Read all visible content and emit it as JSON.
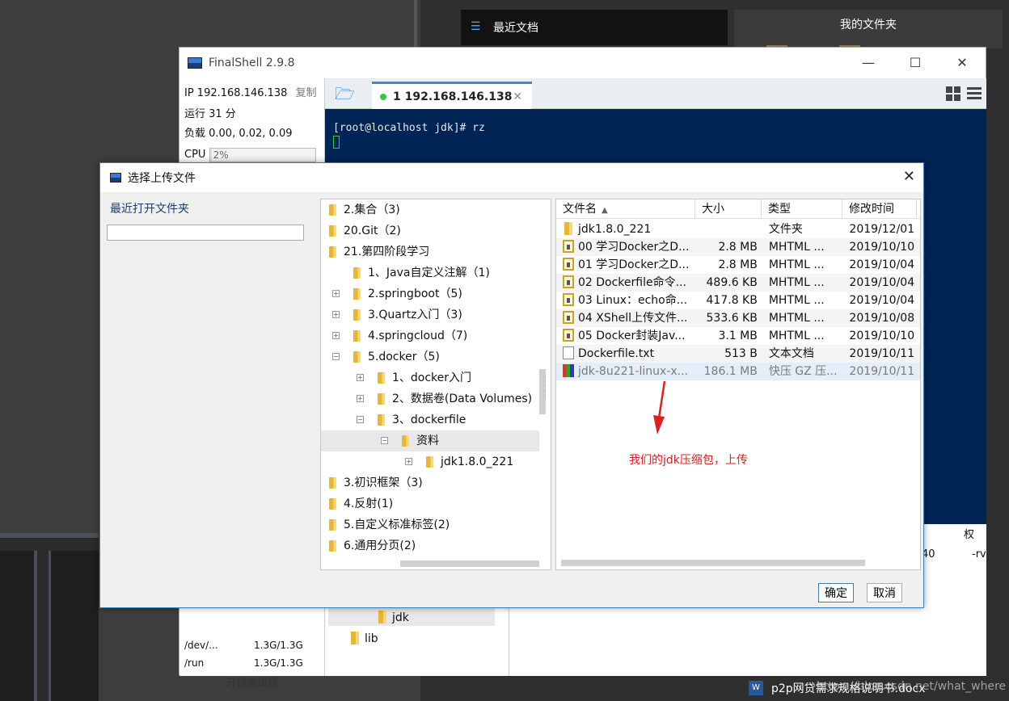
{
  "desktop": {
    "recent_docs_label": "最近文档",
    "my_folder_label": "我的文件夹",
    "taskbar_doc": "p2p网贷需求规格说明书.docx",
    "watermark": "https://blog.csdn.net/what_where"
  },
  "finalshell": {
    "title": "FinalShell 2.9.8",
    "ip_label": "IP 192.168.146.138",
    "copy_label": "复制",
    "uptime": "运行 31 分",
    "load": "负载 0.00, 0.02, 0.09",
    "cpu_label": "CPU",
    "cpu_value": "2%",
    "cpu_fraction": 0.02,
    "disks": [
      {
        "path": "/dev/...",
        "size": "1.3G/1.3G"
      },
      {
        "path": "/run",
        "size": "1.3G/1.3G"
      }
    ],
    "upgrade_label": "升级高级版",
    "tab_label": "1 192.168.146.138",
    "terminal_line": "[root@localhost jdk]# rz",
    "lower_col_head": "权",
    "lower_val1": "40",
    "lower_val2": "-rv",
    "lower_tree": [
      {
        "label": "jdk"
      },
      {
        "label": "lib"
      }
    ]
  },
  "dialog": {
    "title": "选择上传文件",
    "recent_folder_label": "最近打开文件夹",
    "recent_folder_value": "",
    "tree": [
      {
        "label": "2.集合（3)",
        "expander": ""
      },
      {
        "label": "20.Git（2)",
        "expander": ""
      },
      {
        "label": "21.第四阶段学习",
        "expander": ""
      },
      {
        "label": "1、Java自定义注解（1)",
        "expander": ""
      },
      {
        "label": "2.springboot（5)",
        "expander": "+"
      },
      {
        "label": "3.Quartz入门（3)",
        "expander": "+"
      },
      {
        "label": "4.springcloud（7)",
        "expander": "+"
      },
      {
        "label": "5.docker（5)",
        "expander": "−"
      },
      {
        "label": "1、docker入门",
        "expander": "+"
      },
      {
        "label": "2、数据卷(Data Volumes)",
        "expander": "+"
      },
      {
        "label": "3、dockerfile",
        "expander": "−"
      },
      {
        "label": "资料",
        "expander": "−"
      },
      {
        "label": "jdk1.8.0_221",
        "expander": "+"
      },
      {
        "label": "3.初识框架（3)",
        "expander": ""
      },
      {
        "label": "4.反射(1)",
        "expander": ""
      },
      {
        "label": "5.自定义标准标签(2)",
        "expander": ""
      },
      {
        "label": "6.通用分页(2)",
        "expander": ""
      }
    ],
    "columns": {
      "name": "文件名",
      "size": "大小",
      "type": "类型",
      "modified": "修改时间"
    },
    "files": [
      {
        "name": "jdk1.8.0_221",
        "size": "",
        "type": "文件夹",
        "modified": "2019/12/01",
        "icon": "folder-icon"
      },
      {
        "name": "00 学习Docker之D...",
        "size": "2.8 MB",
        "type": "MHTML ...",
        "modified": "2019/10/10",
        "icon": "mhtml-icon"
      },
      {
        "name": "01 学习Docker之D...",
        "size": "2.8 MB",
        "type": "MHTML ...",
        "modified": "2019/10/04",
        "icon": "mhtml-icon"
      },
      {
        "name": "02 Dockerfile命令...",
        "size": "489.6 KB",
        "type": "MHTML ...",
        "modified": "2019/10/04",
        "icon": "mhtml-icon"
      },
      {
        "name": "03 Linux：echo命...",
        "size": "417.8 KB",
        "type": "MHTML ...",
        "modified": "2019/10/04",
        "icon": "mhtml-icon"
      },
      {
        "name": "04 XShell上传文件...",
        "size": "533.6 KB",
        "type": "MHTML ...",
        "modified": "2019/10/08",
        "icon": "mhtml-icon"
      },
      {
        "name": "05 Docker封装Jav...",
        "size": "3.1 MB",
        "type": "MHTML ...",
        "modified": "2019/10/10",
        "icon": "mhtml-icon"
      },
      {
        "name": "Dockerfile.txt",
        "size": "513 B",
        "type": "文本文档",
        "modified": "2019/10/11",
        "icon": "text-file-icon"
      },
      {
        "name": "jdk-8u221-linux-x...",
        "size": "186.1 MB",
        "type": "快压 GZ 压...",
        "modified": "2019/10/11",
        "icon": "archive-icon"
      }
    ],
    "annotation": "我们的jdk压缩包，上传",
    "ok_label": "确定",
    "cancel_label": "取消"
  }
}
